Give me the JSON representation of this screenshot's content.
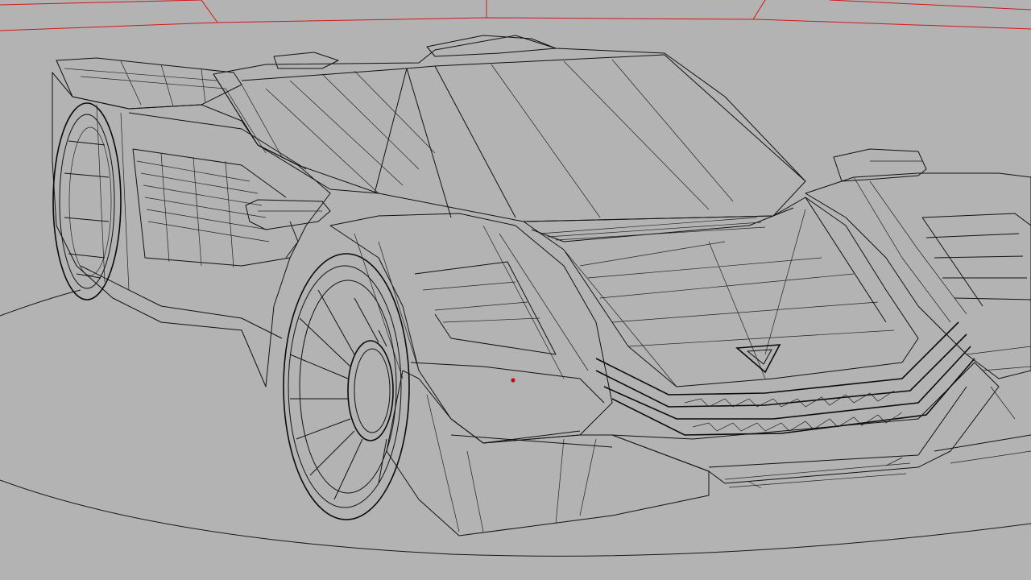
{
  "viewport": {
    "view_mode": "wireframe",
    "object": "sports car",
    "colors": {
      "background": "#b3b3b3",
      "wire": "#111111",
      "scene_boundary": "#d01818",
      "pivot_marker": "#c01010"
    }
  }
}
